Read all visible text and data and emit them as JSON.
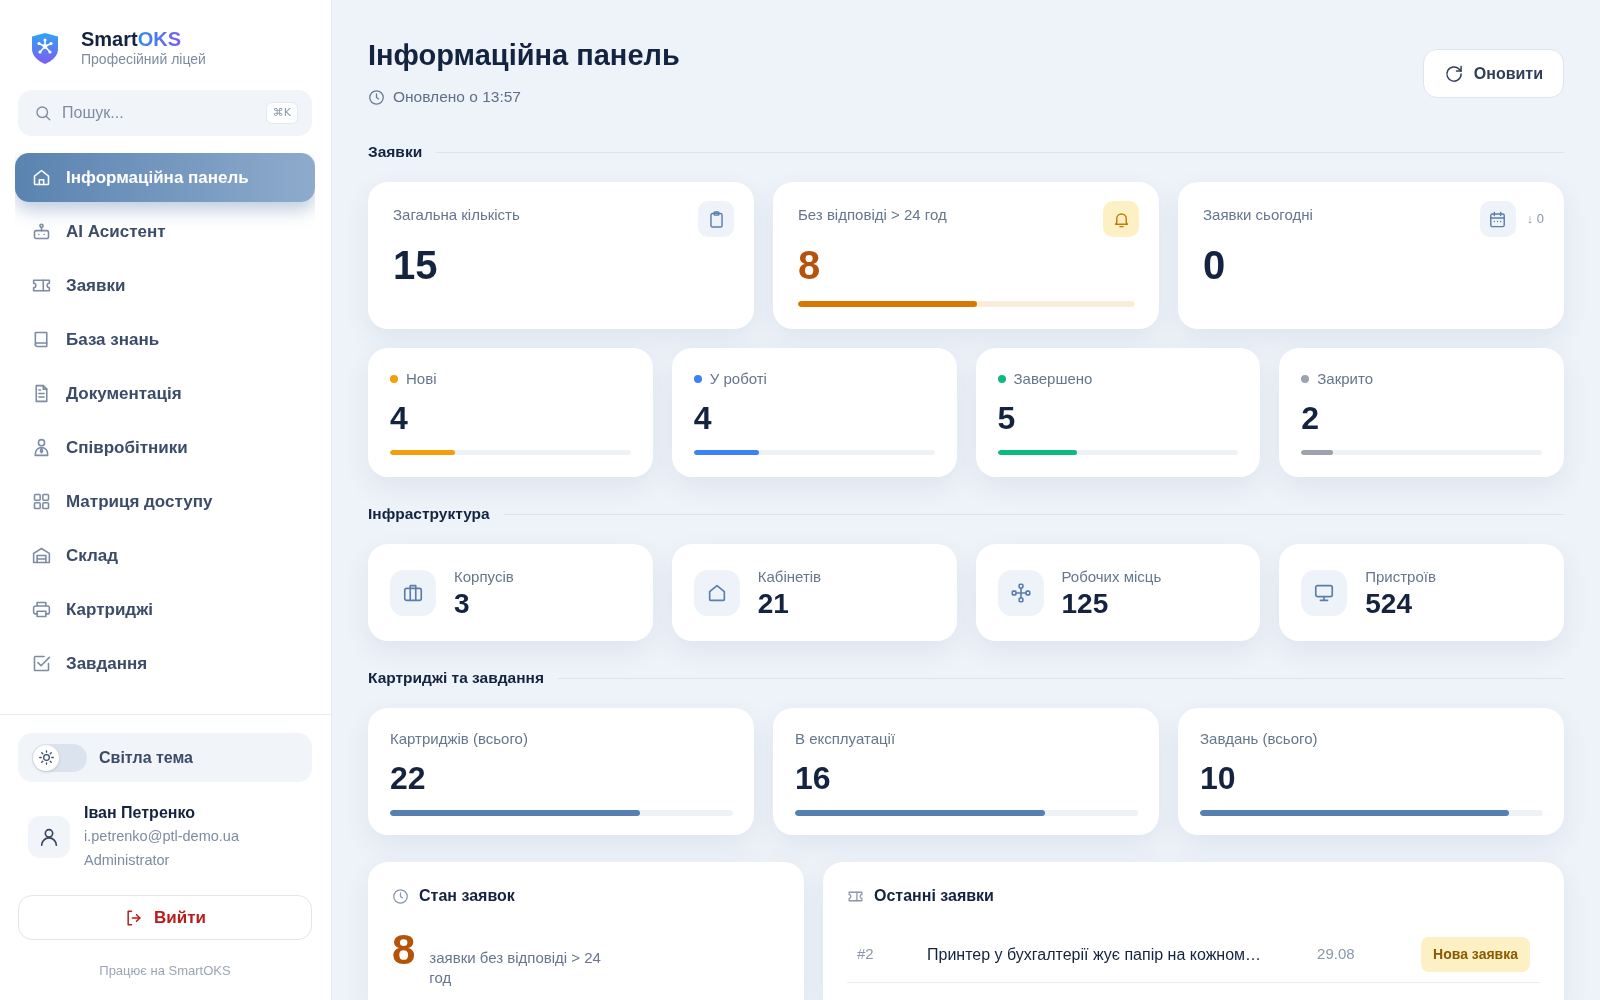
{
  "sidebar": {
    "brand": {
      "name": "Smart",
      "name_accent": "OKS",
      "subtitle": "Професійний ліцей"
    },
    "search": {
      "placeholder": "Пошук...",
      "shortcut": "⌘K"
    },
    "nav_items": [
      {
        "label": "Інформаційна панель",
        "selected": true
      },
      {
        "label": "AI Асистент",
        "selected": false
      },
      {
        "label": "Заявки",
        "selected": false
      },
      {
        "label": "База знань",
        "selected": false
      },
      {
        "label": "Документація",
        "selected": false
      },
      {
        "label": "Співробітники",
        "selected": false
      },
      {
        "label": "Матриця доступу",
        "selected": false
      },
      {
        "label": "Склад",
        "selected": false
      },
      {
        "label": "Картриджі",
        "selected": false
      },
      {
        "label": "Завдання",
        "selected": false
      }
    ],
    "theme_toggle": {
      "label": "Світла тема",
      "on": false
    },
    "user": {
      "name": "Іван Петренко",
      "email": "i.petrenko@ptl-demo.ua",
      "role": "Administrator"
    },
    "logout_button": "Вийти",
    "footer": "Працює на SmartOKS"
  },
  "header": {
    "title": "Інформаційна панель",
    "updated": "Оновлено о 13:57",
    "refresh_button": "Оновити"
  },
  "sections": [
    {
      "title": "Заявки",
      "rows": [
        {
          "cards": [
            {
              "kind": "tile",
              "label": "Загальна кількість",
              "value": "15",
              "alert": false
            },
            {
              "kind": "tile",
              "label": "Без відповіді > 24 год",
              "value": "8",
              "alert": true,
              "level": 0.53
            },
            {
              "kind": "tile",
              "label": "Заявки сьогодні",
              "value": "0",
              "alert": false,
              "trend": "↓ 0"
            }
          ]
        },
        {
          "cards": [
            {
              "kind": "status",
              "label": "Нові",
              "value": "4",
              "color": "#f59e0b",
              "level": 0.27
            },
            {
              "kind": "status",
              "label": "У роботі",
              "value": "4",
              "color": "#3b82f6",
              "level": 0.27
            },
            {
              "kind": "status",
              "label": "Завершено",
              "value": "5",
              "color": "#10b981",
              "level": 0.33
            },
            {
              "kind": "status",
              "label": "Закрито",
              "value": "2",
              "color": "#9ca3af",
              "level": 0.13
            }
          ]
        }
      ]
    },
    {
      "title": "Інфраструктура",
      "rows": [
        {
          "cards": [
            {
              "kind": "infra",
              "label": "Корпусів",
              "value": "3"
            },
            {
              "kind": "infra",
              "label": "Кабінетів",
              "value": "21"
            },
            {
              "kind": "infra",
              "label": "Робочих місць",
              "value": "125"
            },
            {
              "kind": "infra",
              "label": "Пристроїв",
              "value": "524"
            }
          ]
        }
      ]
    },
    {
      "title": "Картриджі та завдання",
      "rows": [
        {
          "cards": [
            {
              "kind": "meter",
              "label": "Картриджів (всього)",
              "value": "22",
              "level": 0.73
            },
            {
              "kind": "meter",
              "label": "В експлуатації",
              "value": "16",
              "level": 0.73
            },
            {
              "kind": "meter",
              "label": "Завдань (всього)",
              "value": "10",
              "level": 0.9
            }
          ]
        }
      ]
    }
  ],
  "panels": {
    "ticket_state": {
      "title": "Стан заявок",
      "value": "8",
      "caption": "заявки без відповіді > 24 год"
    },
    "recent_tickets": {
      "title": "Останні заявки",
      "rows": [
        {
          "number": "#2",
          "title": "Принтер у бухгалтерії жує папір на кожном…",
          "date": "29.08",
          "status": "Нова заявка"
        }
      ]
    }
  }
}
